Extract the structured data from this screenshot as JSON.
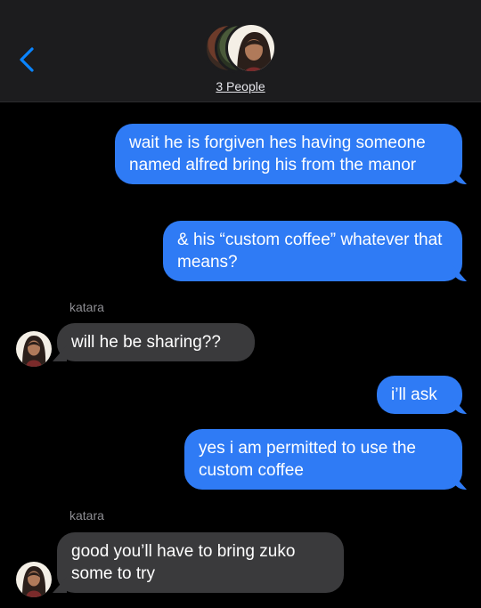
{
  "header": {
    "group_name": "3 People",
    "colors": {
      "background": "#1c1c1e",
      "accent": "#0a84ff"
    }
  },
  "messages": [
    {
      "direction": "sent",
      "text": "wait he is forgiven hes having someone named alfred bring his from the manor"
    },
    {
      "direction": "sent",
      "text": "& his “custom coffee” whatever that means?"
    },
    {
      "direction": "received",
      "sender": "katara",
      "text": "will he be sharing??"
    },
    {
      "direction": "sent",
      "text": "i’ll ask"
    },
    {
      "direction": "sent",
      "text": "yes i am permitted to use the custom coffee"
    },
    {
      "direction": "received",
      "sender": "katara",
      "text": "good you’ll have to bring zuko some to try"
    }
  ],
  "colors": {
    "sent_bubble": "#2f7bf5",
    "received_bubble": "#3a3a3c",
    "sender_label": "#8e8e93"
  }
}
